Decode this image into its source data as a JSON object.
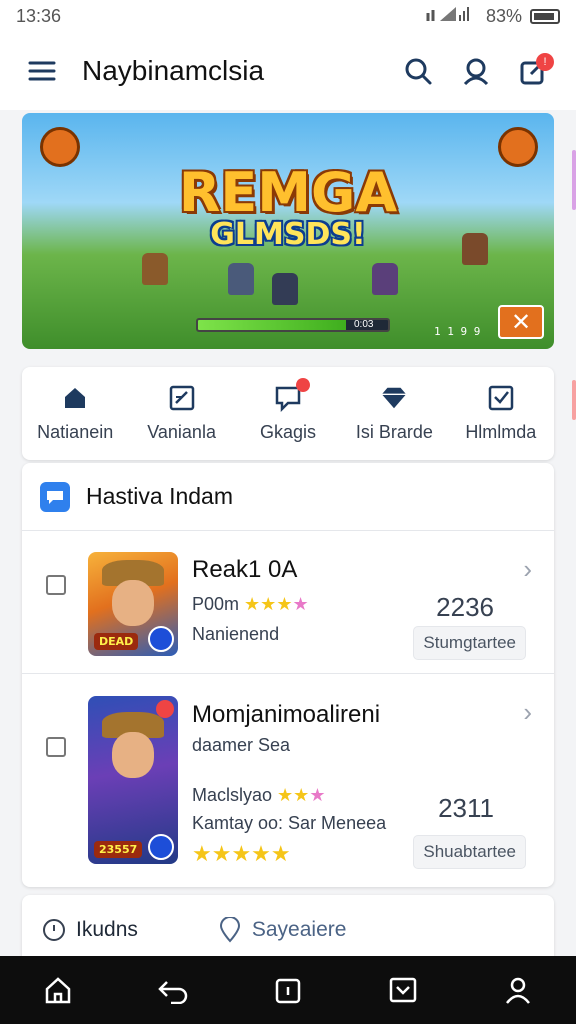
{
  "status_bar": {
    "time": "13:36",
    "battery": "83%"
  },
  "header": {
    "title": "Naybinamclsia"
  },
  "banner": {
    "title": "REMGA",
    "subtitle": "GLMSDS!",
    "progress_label": "0:03",
    "progress_fraction": 0.78,
    "counter": "1 1 9 9"
  },
  "nav": {
    "items": [
      {
        "label": "Natianein",
        "icon": "home-icon"
      },
      {
        "label": "Vanianla",
        "icon": "edit-icon"
      },
      {
        "label": "Gkagis",
        "icon": "chat-icon"
      },
      {
        "label": "Isi Brarde",
        "icon": "diamond-icon"
      },
      {
        "label": "Hlmlmda",
        "icon": "checkbox-icon"
      }
    ]
  },
  "section": {
    "title": "Hastiva Indam"
  },
  "games": [
    {
      "title": "Reak1 0A",
      "line1": "P00m",
      "line2": "Nanienend",
      "number": "2236",
      "button": "Stumgtartee",
      "thumb_tag": "DEAD"
    },
    {
      "title": "Momjanimoalireni",
      "line1": "daamer Sea",
      "line2": "Maclslyao",
      "line3": "Kamtay oo: Sar Meneea",
      "number": "2311",
      "button": "Shuabtartee",
      "thumb_tag": "23557"
    }
  ],
  "bottom": {
    "left": "Ikudns",
    "right": "Sayeaiere"
  },
  "colors": {
    "accent": "#2f80ed",
    "badge": "#ef4444",
    "star": "#f5c518",
    "banner_orange": "#e2701e"
  }
}
